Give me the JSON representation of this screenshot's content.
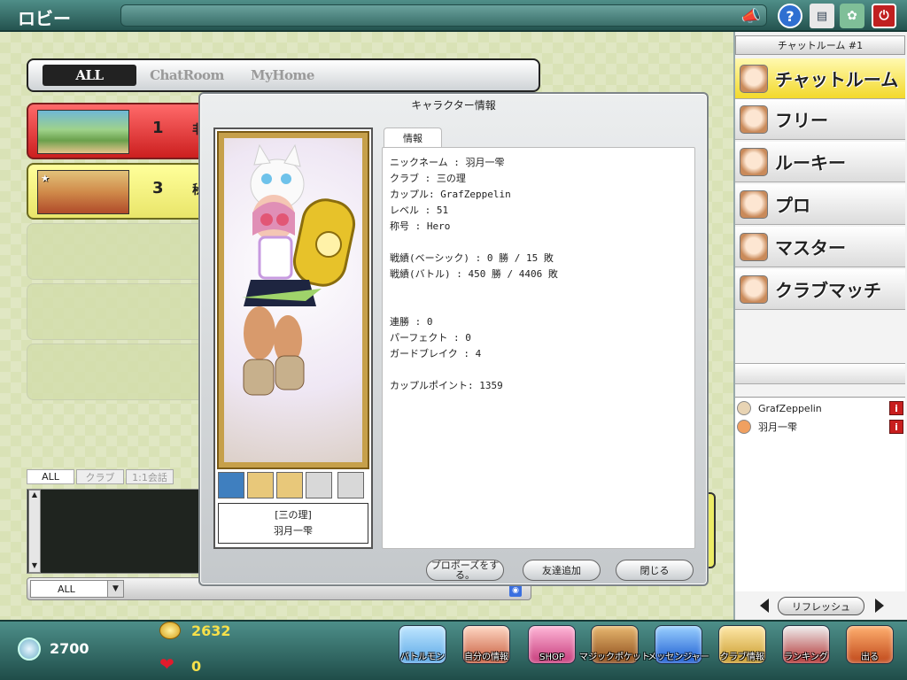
{
  "header": {
    "title": "ロビー"
  },
  "lobby_tabs": [
    {
      "label": "ALL"
    },
    {
      "label": "ChatRoom"
    },
    {
      "label": "MyHome"
    }
  ],
  "rooms": [
    {
      "number": "1",
      "name": "非"
    },
    {
      "number": "3",
      "name": "秘"
    }
  ],
  "chat": {
    "tabs": [
      {
        "label": "ALL"
      },
      {
        "label": "クラブ"
      },
      {
        "label": "1:1会話"
      }
    ],
    "filter_value": "ALL"
  },
  "modal": {
    "title": "キャラクター情報",
    "tab_label": "情報",
    "name_club": "[三の理]",
    "name_player": "羽月一雫",
    "info_group1": [
      "ニックネーム : 羽月一雫",
      "クラブ : 三の理",
      "カップル:  GrafZeppelin",
      "レベル : 51",
      "称号 : Hero"
    ],
    "info_group2": [
      "戦績(ベーシック) : 0 勝 / 15 敗",
      "戦績(バトル) : 450 勝 / 4406 敗"
    ],
    "info_group3": [
      "連勝 : 0",
      "パーフェクト : 0",
      "ガードブレイク : 4"
    ],
    "info_group4": [
      "カップルポイント:  1359"
    ],
    "buttons": {
      "propose": "プロポーズをする。",
      "add_friend": "友達追加",
      "close": "閉じる"
    }
  },
  "sidebar": {
    "room_label": "チャットルーム #1",
    "channels": [
      {
        "label": "チャットルーム"
      },
      {
        "label": "フリー"
      },
      {
        "label": "ルーキー"
      },
      {
        "label": "プロ"
      },
      {
        "label": "マスター"
      },
      {
        "label": "クラブマッチ"
      }
    ],
    "users": [
      {
        "name": "GrafZeppelin",
        "badge": "i"
      },
      {
        "name": "羽月一雫",
        "badge": "i"
      }
    ],
    "refresh_label": "リフレッシュ"
  },
  "footer": {
    "coins": "2700",
    "gold": "2632",
    "hearts": "0",
    "menu": [
      {
        "label": "バトルモン"
      },
      {
        "label": "自分の情報"
      },
      {
        "label": "SHOP"
      },
      {
        "label": "マジックポケット"
      },
      {
        "label": "メッセンジャー"
      },
      {
        "label": "クラブ情報"
      },
      {
        "label": "ランキング"
      },
      {
        "label": "出る"
      }
    ]
  }
}
